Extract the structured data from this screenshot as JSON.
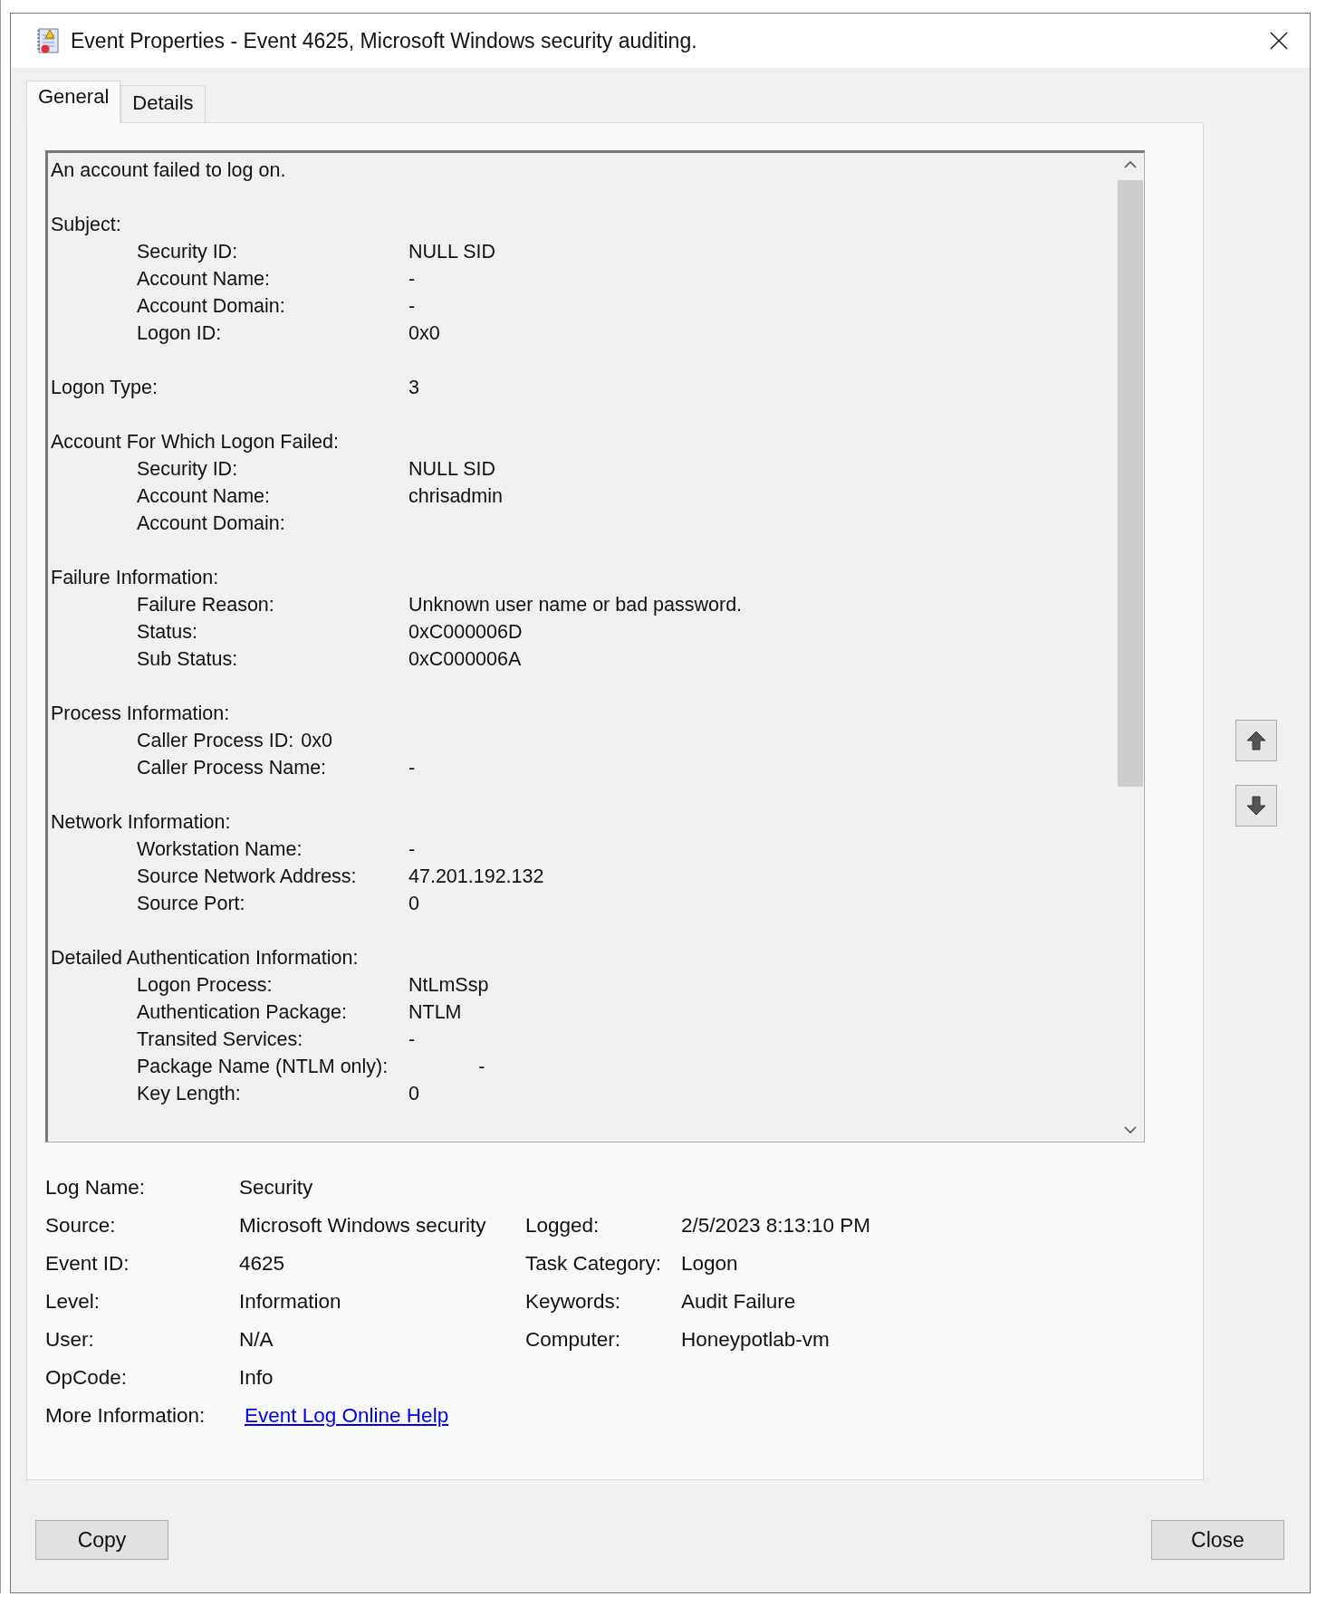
{
  "window": {
    "title": "Event Properties - Event 4625, Microsoft Windows security auditing."
  },
  "tabs": [
    {
      "label": "General",
      "selected": true
    },
    {
      "label": "Details",
      "selected": false
    }
  ],
  "description": {
    "first_line": "An account failed to log on.",
    "sections": [
      {
        "heading": "Subject:",
        "fields": [
          {
            "kind": "column",
            "label": "Security ID:",
            "value": "NULL SID"
          },
          {
            "kind": "column",
            "label": "Account Name:",
            "value": "-"
          },
          {
            "kind": "column",
            "label": "Account Domain:",
            "value": "-"
          },
          {
            "kind": "column",
            "label": "Logon ID:",
            "value": "0x0"
          }
        ]
      },
      {
        "heading": "Logon Type:",
        "value": "3"
      },
      {
        "heading": "Account For Which Logon Failed:",
        "fields": [
          {
            "kind": "column",
            "label": "Security ID:",
            "value": "NULL SID"
          },
          {
            "kind": "column",
            "label": "Account Name:",
            "value": "chrisadmin"
          },
          {
            "kind": "column",
            "label": "Account Domain:"
          }
        ]
      },
      {
        "heading": "Failure Information:",
        "fields": [
          {
            "kind": "column",
            "label": "Failure Reason:",
            "value": "Unknown user name or bad password."
          },
          {
            "kind": "column",
            "label": "Status:",
            "value": "0xC000006D"
          },
          {
            "kind": "column",
            "label": "Sub Status:",
            "value": "0xC000006A"
          }
        ]
      },
      {
        "heading": "Process Information:",
        "fields": [
          {
            "kind": "inline",
            "label": "Caller Process ID:",
            "value": "0x0"
          },
          {
            "kind": "column",
            "label": "Caller Process Name:",
            "value": "-"
          }
        ]
      },
      {
        "heading": "Network Information:",
        "fields": [
          {
            "kind": "column",
            "label": "Workstation Name:",
            "value": "-"
          },
          {
            "kind": "column",
            "label": "Source Network Address:",
            "value": "47.201.192.132"
          },
          {
            "kind": "column",
            "label": "Source Port:",
            "value": "0"
          }
        ]
      },
      {
        "heading": "Detailed Authentication Information:",
        "fields": [
          {
            "kind": "column",
            "label": "Logon Process:",
            "value": "NtLmSsp"
          },
          {
            "kind": "column",
            "label": "Authentication Package:",
            "value": "NTLM"
          },
          {
            "kind": "column",
            "label": "Transited Services:",
            "value": "-"
          },
          {
            "kind": "next-stop",
            "label": "Package Name (NTLM only):",
            "value": "-"
          },
          {
            "kind": "column",
            "label": "Key Length:",
            "value": "0"
          }
        ]
      }
    ]
  },
  "properties": {
    "left": [
      {
        "label": "Log Name:",
        "value": "Security"
      },
      {
        "label": "Source:",
        "value": "Microsoft Windows security"
      },
      {
        "label": "Event ID:",
        "value": "4625"
      },
      {
        "label": "Level:",
        "value": "Information"
      },
      {
        "label": "User:",
        "value": "N/A"
      },
      {
        "label": "OpCode:",
        "value": "Info"
      }
    ],
    "right": [
      {
        "label": "Logged:",
        "value": "2/5/2023 8:13:10 PM"
      },
      {
        "label": "Task Category:",
        "value": "Logon"
      },
      {
        "label": "Keywords:",
        "value": "Audit Failure"
      },
      {
        "label": "Computer:",
        "value": "Honeypotlab-vm"
      }
    ],
    "more_information": {
      "label": "More Information:",
      "link": "Event Log Online Help"
    }
  },
  "buttons": {
    "copy": "Copy",
    "close": "Close"
  }
}
